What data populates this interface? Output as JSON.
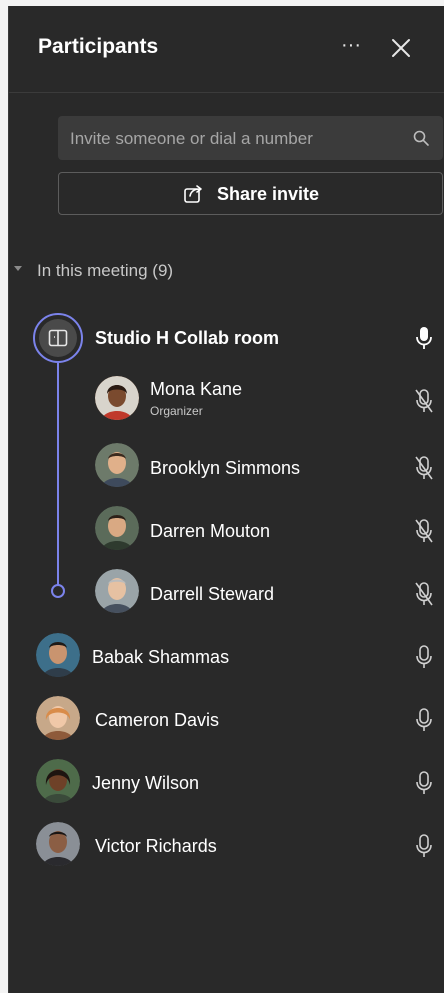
{
  "header": {
    "title": "Participants"
  },
  "search": {
    "placeholder": "Invite someone or dial a number"
  },
  "share": {
    "label": "Share invite"
  },
  "section": {
    "label": "In this meeting (9)"
  },
  "room": {
    "name": "Studio H Collab room"
  },
  "room_members": [
    {
      "name": "Mona Kane",
      "role": "Organizer",
      "muted": true
    },
    {
      "name": "Brooklyn Simmons",
      "muted": true
    },
    {
      "name": "Darren Mouton",
      "muted": true
    },
    {
      "name": "Darrell Steward",
      "muted": true
    }
  ],
  "others": [
    {
      "name": "Babak Shammas",
      "muted": false
    },
    {
      "name": "Cameron Davis",
      "muted": false
    },
    {
      "name": "Jenny Wilson",
      "muted": false
    },
    {
      "name": "Victor Richards",
      "muted": false
    }
  ],
  "colors": {
    "panel": "#292929",
    "accent": "#7b83eb",
    "text": "#ffffff"
  }
}
